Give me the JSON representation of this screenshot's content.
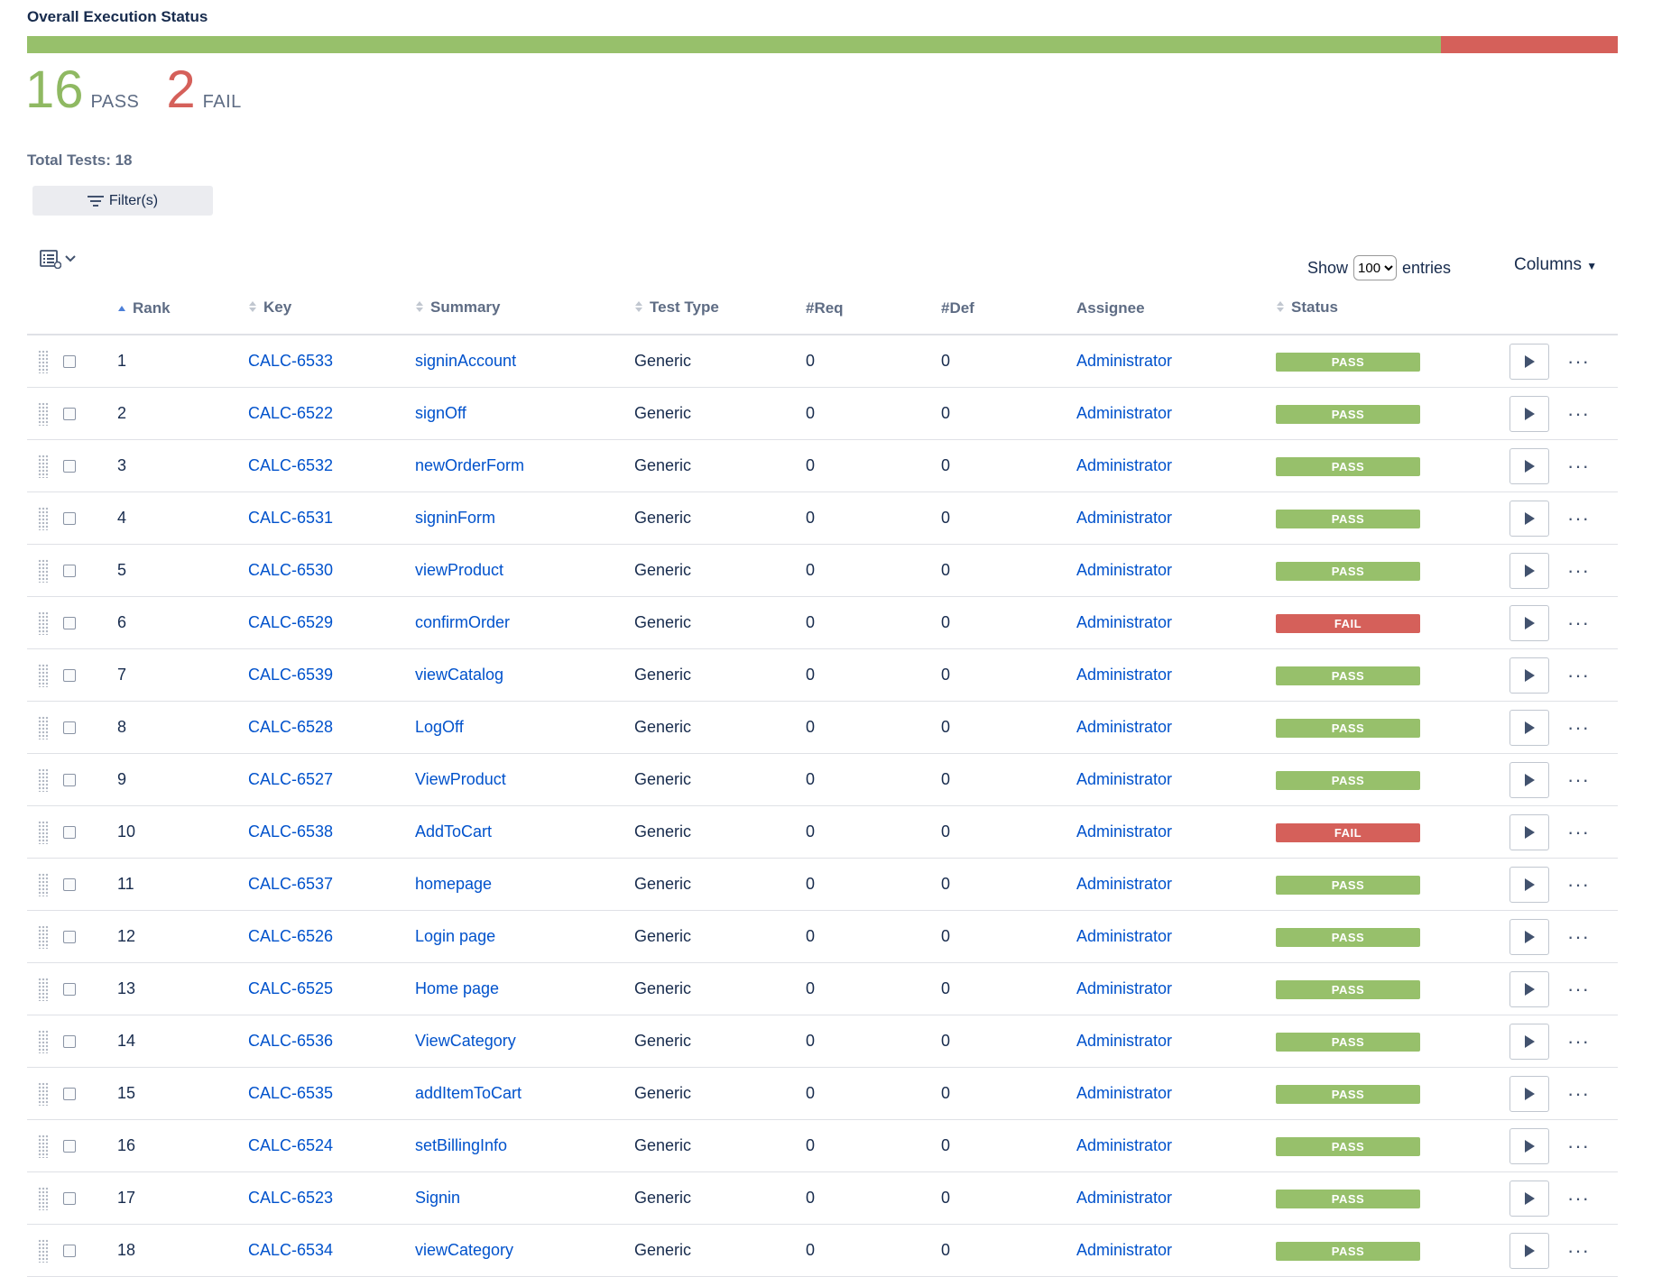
{
  "header": {
    "title": "Overall Execution Status",
    "pass_count": "16",
    "pass_label": "PASS",
    "fail_count": "2",
    "fail_label": "FAIL",
    "pass_fraction": 0.889,
    "fail_fraction": 0.111,
    "total_label": "Total Tests: 18"
  },
  "toolbar": {
    "filter_label": "Filter(s)",
    "view_icon": "list-view-icon",
    "show_prefix": "Show",
    "show_value": "100",
    "show_suffix": "entries",
    "columns_label": "Columns"
  },
  "colors": {
    "pass": "#97c06b",
    "fail": "#d5605a",
    "link": "#0052cc"
  },
  "table": {
    "headers": {
      "rank": "Rank",
      "key": "Key",
      "summary": "Summary",
      "test_type": "Test Type",
      "req": "#Req",
      "def": "#Def",
      "assignee": "Assignee",
      "status": "Status"
    },
    "rows": [
      {
        "rank": "1",
        "key": "CALC-6533",
        "summary": "signinAccount",
        "type": "Generic",
        "req": "0",
        "def": "0",
        "assignee": "Administrator",
        "status": "PASS"
      },
      {
        "rank": "2",
        "key": "CALC-6522",
        "summary": "signOff",
        "type": "Generic",
        "req": "0",
        "def": "0",
        "assignee": "Administrator",
        "status": "PASS"
      },
      {
        "rank": "3",
        "key": "CALC-6532",
        "summary": "newOrderForm",
        "type": "Generic",
        "req": "0",
        "def": "0",
        "assignee": "Administrator",
        "status": "PASS"
      },
      {
        "rank": "4",
        "key": "CALC-6531",
        "summary": "signinForm",
        "type": "Generic",
        "req": "0",
        "def": "0",
        "assignee": "Administrator",
        "status": "PASS"
      },
      {
        "rank": "5",
        "key": "CALC-6530",
        "summary": "viewProduct",
        "type": "Generic",
        "req": "0",
        "def": "0",
        "assignee": "Administrator",
        "status": "PASS"
      },
      {
        "rank": "6",
        "key": "CALC-6529",
        "summary": "confirmOrder",
        "type": "Generic",
        "req": "0",
        "def": "0",
        "assignee": "Administrator",
        "status": "FAIL"
      },
      {
        "rank": "7",
        "key": "CALC-6539",
        "summary": "viewCatalog",
        "type": "Generic",
        "req": "0",
        "def": "0",
        "assignee": "Administrator",
        "status": "PASS"
      },
      {
        "rank": "8",
        "key": "CALC-6528",
        "summary": "LogOff",
        "type": "Generic",
        "req": "0",
        "def": "0",
        "assignee": "Administrator",
        "status": "PASS"
      },
      {
        "rank": "9",
        "key": "CALC-6527",
        "summary": "ViewProduct",
        "type": "Generic",
        "req": "0",
        "def": "0",
        "assignee": "Administrator",
        "status": "PASS"
      },
      {
        "rank": "10",
        "key": "CALC-6538",
        "summary": "AddToCart",
        "type": "Generic",
        "req": "0",
        "def": "0",
        "assignee": "Administrator",
        "status": "FAIL"
      },
      {
        "rank": "11",
        "key": "CALC-6537",
        "summary": "homepage",
        "type": "Generic",
        "req": "0",
        "def": "0",
        "assignee": "Administrator",
        "status": "PASS"
      },
      {
        "rank": "12",
        "key": "CALC-6526",
        "summary": "Login page",
        "type": "Generic",
        "req": "0",
        "def": "0",
        "assignee": "Administrator",
        "status": "PASS"
      },
      {
        "rank": "13",
        "key": "CALC-6525",
        "summary": "Home page",
        "type": "Generic",
        "req": "0",
        "def": "0",
        "assignee": "Administrator",
        "status": "PASS"
      },
      {
        "rank": "14",
        "key": "CALC-6536",
        "summary": "ViewCategory",
        "type": "Generic",
        "req": "0",
        "def": "0",
        "assignee": "Administrator",
        "status": "PASS"
      },
      {
        "rank": "15",
        "key": "CALC-6535",
        "summary": "addItemToCart",
        "type": "Generic",
        "req": "0",
        "def": "0",
        "assignee": "Administrator",
        "status": "PASS"
      },
      {
        "rank": "16",
        "key": "CALC-6524",
        "summary": "setBillingInfo",
        "type": "Generic",
        "req": "0",
        "def": "0",
        "assignee": "Administrator",
        "status": "PASS"
      },
      {
        "rank": "17",
        "key": "CALC-6523",
        "summary": "Signin",
        "type": "Generic",
        "req": "0",
        "def": "0",
        "assignee": "Administrator",
        "status": "PASS"
      },
      {
        "rank": "18",
        "key": "CALC-6534",
        "summary": "viewCategory",
        "type": "Generic",
        "req": "0",
        "def": "0",
        "assignee": "Administrator",
        "status": "PASS"
      }
    ]
  }
}
